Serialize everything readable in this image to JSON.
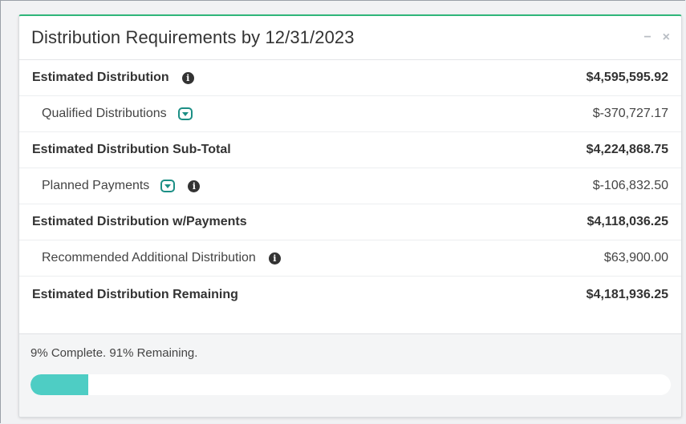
{
  "panel": {
    "title": "Distribution Requirements by 12/31/2023",
    "minimize_label": "−",
    "close_label": "×"
  },
  "rows": [
    {
      "label": "Estimated Distribution",
      "value": "$4,595,595.92"
    },
    {
      "label": "Qualified Distributions",
      "value": "$-370,727.17"
    },
    {
      "label": "Estimated Distribution Sub-Total",
      "value": "$4,224,868.75"
    },
    {
      "label": "Planned Payments",
      "value": "$-106,832.50"
    },
    {
      "label": "Estimated Distribution w/Payments",
      "value": "$4,118,036.25"
    },
    {
      "label": "Recommended Additional Distribution",
      "value": "$63,900.00"
    },
    {
      "label": "Estimated Distribution Remaining",
      "value": "$4,181,936.25"
    }
  ],
  "progress": {
    "text": "9% Complete. 91% Remaining.",
    "complete_percent": 9
  },
  "colors": {
    "accent": "#2fb67a",
    "progress_fill": "#4ecdc4",
    "toggle_border": "#1c8f85"
  },
  "icons": {
    "info": "info-circle-icon",
    "toggle": "caret-down-icon"
  }
}
